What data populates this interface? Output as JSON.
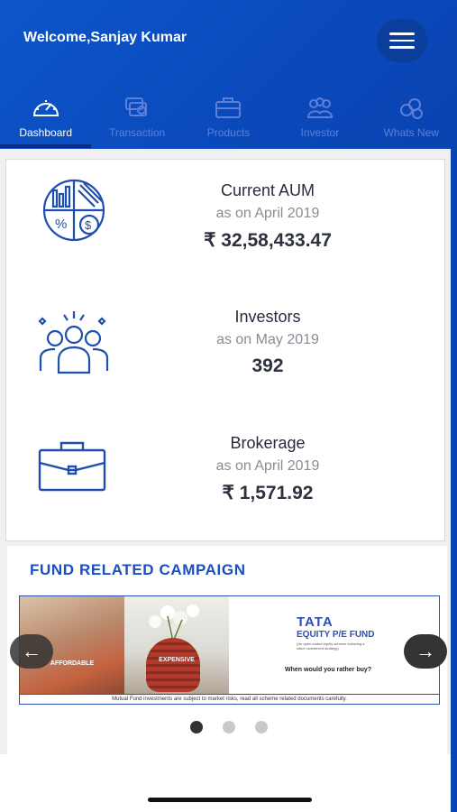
{
  "header": {
    "welcome_text": "Welcome,Sanjay Kumar"
  },
  "tabs": [
    {
      "label": "Dashboard",
      "icon": "speedometer-icon",
      "active": true
    },
    {
      "label": "Transaction",
      "icon": "money-icon",
      "active": false
    },
    {
      "label": "Products",
      "icon": "briefcase-icon",
      "active": false
    },
    {
      "label": "Investor",
      "icon": "team-icon",
      "active": false
    },
    {
      "label": "Whats New",
      "icon": "coins-icon",
      "active": false
    }
  ],
  "stats": [
    {
      "title": "Current AUM",
      "date": "as on April 2019",
      "value": "₹ 32,58,433.47",
      "icon": "pie-chart-finance-icon"
    },
    {
      "title": "Investors",
      "date": "as on May 2019",
      "value": "392",
      "icon": "investors-group-icon"
    },
    {
      "title": "Brokerage",
      "date": "as on April 2019",
      "value": "₹ 1,571.92",
      "icon": "briefcase-icon"
    }
  ],
  "campaign": {
    "title": "FUND RELATED CAMPAIGN",
    "banner": {
      "left_label": "AFFORDABLE",
      "mid_label": "EXPENSIVE",
      "brand": "TATA",
      "fund_name": "EQUITY P/E FUND",
      "fund_sub": "(An open ended equity scheme following a value investment strategy)",
      "question": "When would you rather buy?",
      "disclaimer": "Mutual Fund investments are subject to market risks, read all scheme related documents carefully."
    },
    "prev_arrow": "←",
    "next_arrow": "→",
    "carousel_pages": 3,
    "carousel_active_index": 0
  },
  "colors": {
    "brand_blue": "#0d55c9",
    "accent_blue": "#1a4fc4",
    "icon_blue": "#1f4fae"
  }
}
